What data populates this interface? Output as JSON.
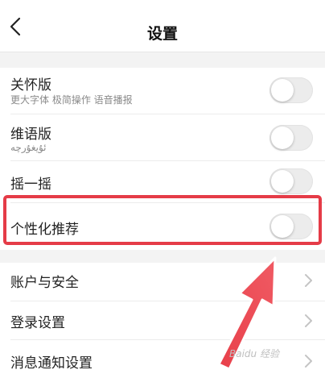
{
  "header": {
    "title": "设置"
  },
  "toggles": [
    {
      "label": "关怀版",
      "sub": "更大字体 极简操作 语音播报",
      "on": false
    },
    {
      "label": "维语版",
      "sub": "ئۇيغۇرچە",
      "on": false
    },
    {
      "label": "摇一摇",
      "on": false
    },
    {
      "label": "个性化推荐",
      "on": false
    }
  ],
  "nav_items": [
    {
      "label": "账户与安全"
    },
    {
      "label": "登录设置"
    },
    {
      "label": "消息通知设置"
    }
  ],
  "colors": {
    "highlight": "#e53b47",
    "toggle_off": "#ececec"
  },
  "watermark": "Baidu 经验"
}
